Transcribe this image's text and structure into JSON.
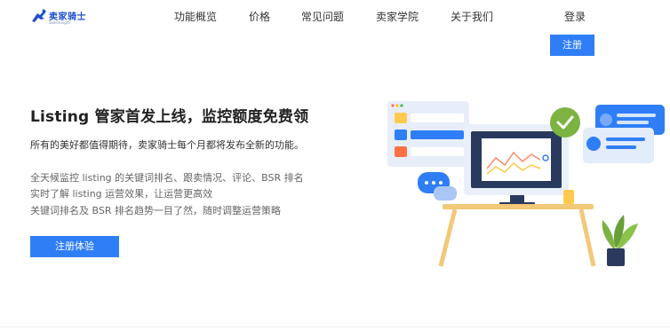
{
  "brand": {
    "name": "卖家骑士",
    "tagline": "Sellerknight"
  },
  "nav": {
    "items": [
      {
        "label": "功能概览"
      },
      {
        "label": "价格"
      },
      {
        "label": "常见问题"
      },
      {
        "label": "卖家学院"
      },
      {
        "label": "关于我们"
      }
    ],
    "login_label": "登录",
    "register_label": "注册"
  },
  "hero": {
    "headline": "Listing 管家首发上线，监控额度免费领",
    "subline": "所有的美好都值得期待，卖家骑士每个月都将发布全新的功能。",
    "features": [
      "全天候监控 listing 的关键词排名、跟卖情况、评论、BSR 排名",
      "实时了解 listing 运营效果，让运营更高效",
      "关键词排名及 BSR 排名趋势一目了然，随时调整运营策略"
    ],
    "cta_label": "注册体验"
  },
  "colors": {
    "accent": "#2f7ef6",
    "brand": "#1e4fd0",
    "check": "#7cb342"
  },
  "icons": [
    "knight-logo-icon",
    "check-icon",
    "chat-bubble-icon",
    "plant-icon"
  ]
}
